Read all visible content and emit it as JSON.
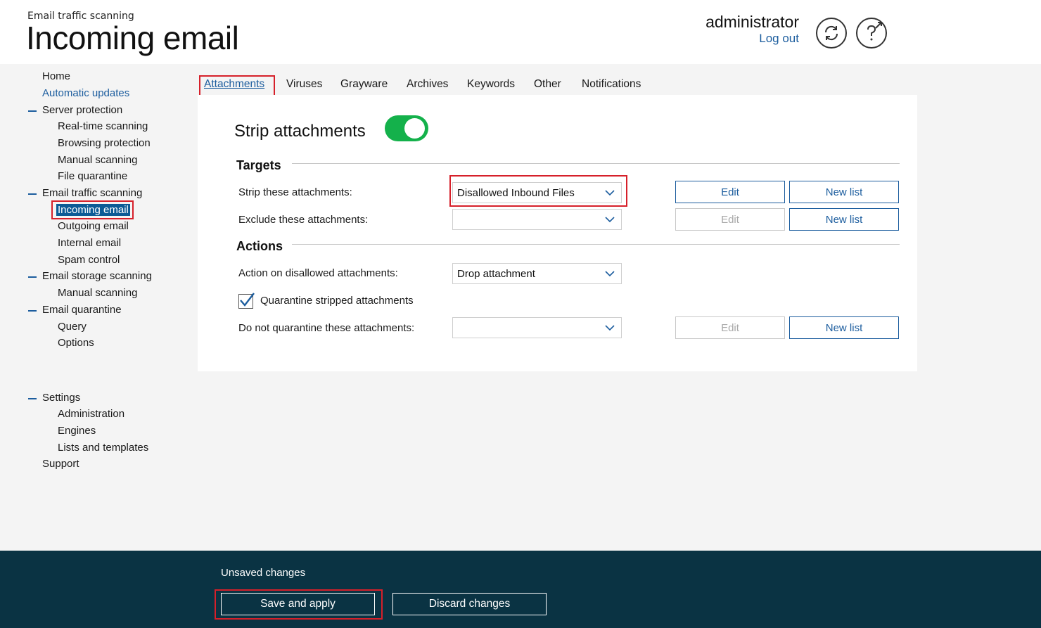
{
  "header": {
    "breadcrumb": "Email traffic scanning",
    "title": "Incoming email",
    "user": "administrator",
    "logout_label": "Log out",
    "refresh_icon": "refresh-icon",
    "help_icon": "help-icon"
  },
  "sidebar": {
    "home": "Home",
    "automatic_updates": "Automatic updates",
    "server_protection": "Server protection",
    "realtime_scanning": "Real-time scanning",
    "browsing_protection": "Browsing protection",
    "manual_scanning": "Manual scanning",
    "file_quarantine": "File quarantine",
    "email_traffic_scanning": "Email traffic scanning",
    "incoming_email": "Incoming email",
    "outgoing_email": "Outgoing email",
    "internal_email": "Internal email",
    "spam_control": "Spam control",
    "email_storage_scanning": "Email storage scanning",
    "storage_manual_scanning": "Manual scanning",
    "email_quarantine": "Email quarantine",
    "query": "Query",
    "options": "Options",
    "settings": "Settings",
    "administration": "Administration",
    "engines": "Engines",
    "lists_and_templates": "Lists and templates",
    "support": "Support"
  },
  "tabs": [
    "Attachments",
    "Viruses",
    "Grayware",
    "Archives",
    "Keywords",
    "Other",
    "Notifications"
  ],
  "panel": {
    "title": "Strip attachments",
    "toggle_on": true,
    "targets_title": "Targets",
    "strip_label": "Strip these attachments:",
    "strip_value": "Disallowed Inbound Files",
    "exclude_label": "Exclude these attachments:",
    "exclude_value": "",
    "actions_title": "Actions",
    "action_label": "Action on disallowed attachments:",
    "action_value": "Drop attachment",
    "quarantine_label": "Quarantine stripped attachments",
    "quarantine_checked": true,
    "noquarantine_label": "Do not quarantine these attachments:",
    "noquarantine_value": "",
    "edit_label": "Edit",
    "new_list_label": "New list"
  },
  "footer": {
    "status": "Unsaved changes",
    "save_label": "Save and apply",
    "discard_label": "Discard changes"
  },
  "colors": {
    "accent": "#1c5d9e",
    "toggle": "#14b14b",
    "footer": "#0a3343",
    "highlight": "#d6202a"
  }
}
